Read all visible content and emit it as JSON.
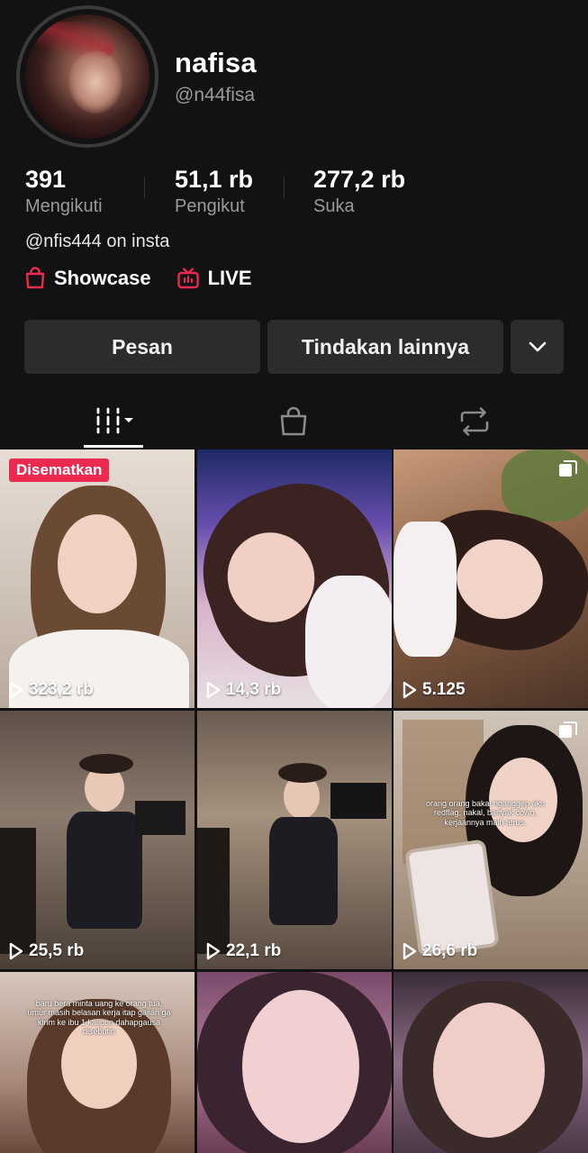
{
  "profile": {
    "name": "nafisa",
    "handle": "@n44fisa",
    "bio": "@nfis444 on insta"
  },
  "stats": [
    {
      "value": "391",
      "label": "Mengikuti"
    },
    {
      "value": "51,1 rb",
      "label": "Pengikut"
    },
    {
      "value": "277,2 rb",
      "label": "Suka"
    }
  ],
  "links": {
    "showcase": "Showcase",
    "live": "LIVE"
  },
  "buttons": {
    "message": "Pesan",
    "more_actions": "Tindakan lainnya"
  },
  "tabs": [
    {
      "icon": "videos-grid-icon",
      "active": true
    },
    {
      "icon": "shopping-bag-icon",
      "active": false
    },
    {
      "icon": "repost-icon",
      "active": false
    }
  ],
  "colors": {
    "background": "#121212",
    "button": "#2c2c2c",
    "accent_red": "#ea2a4f",
    "muted_text": "#9a9a9a"
  },
  "videos": [
    {
      "views": "323,2 rb",
      "pinned_label": "Disematkan",
      "multi": false
    },
    {
      "views": "14,3 rb",
      "multi": false
    },
    {
      "views": "5.125",
      "multi": true
    },
    {
      "views": "25,5 rb",
      "multi": false
    },
    {
      "views": "22,1 rb",
      "multi": false
    },
    {
      "views": "26,6 rb",
      "multi": true,
      "caption": "orang orang bakal nganggep aku redflag, nakal, banyak cowo, kerjaannya main terus."
    },
    {
      "views": "",
      "multi": false,
      "caption": "baru bera minta uang ke orang tua, umur masih belasan kerja itap gajian ga kirim ke ibu 1 kalipun dahapgausa disebutin"
    },
    {
      "views": "",
      "multi": false
    },
    {
      "views": "",
      "multi": false
    }
  ]
}
